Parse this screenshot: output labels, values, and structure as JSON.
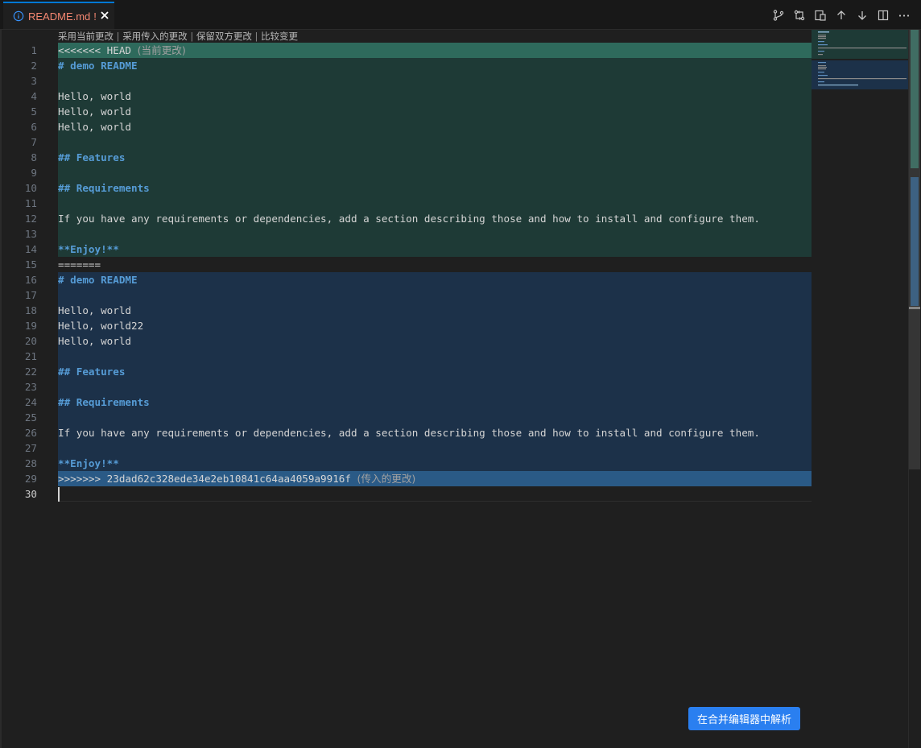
{
  "tab": {
    "file_name": "README.md",
    "modified_marker": "!",
    "icon": "info-icon",
    "close_icon": "close-icon"
  },
  "toolbar": {
    "icons": [
      "source-control-icon",
      "git-compare-icon",
      "open-changes-icon",
      "arrow-up-icon",
      "arrow-down-icon",
      "split-editor-icon",
      "more-actions-icon"
    ]
  },
  "codelens": {
    "accept_current": "采用当前更改",
    "accept_incoming": "采用传入的更改",
    "accept_both": "保留双方更改",
    "compare": "比较变更",
    "separator": " | "
  },
  "lines": [
    {
      "n": "1",
      "text": "<<<<<<< HEAD",
      "annotation": "(当前更改)",
      "kind": "marker"
    },
    {
      "n": "2",
      "text": "# demo README",
      "kind": "heading"
    },
    {
      "n": "3",
      "text": "",
      "kind": "text"
    },
    {
      "n": "4",
      "text": "Hello, world",
      "kind": "text"
    },
    {
      "n": "5",
      "text": "Hello, world",
      "kind": "text"
    },
    {
      "n": "6",
      "text": "Hello, world",
      "kind": "text"
    },
    {
      "n": "7",
      "text": "",
      "kind": "text"
    },
    {
      "n": "8",
      "text": "## Features",
      "kind": "heading"
    },
    {
      "n": "9",
      "text": "",
      "kind": "text"
    },
    {
      "n": "10",
      "text": "## Requirements",
      "kind": "heading"
    },
    {
      "n": "11",
      "text": "",
      "kind": "text"
    },
    {
      "n": "12",
      "text": "If you have any requirements or dependencies, add a section describing those and how to install and configure them.",
      "kind": "text"
    },
    {
      "n": "13",
      "text": "",
      "kind": "text"
    },
    {
      "n": "14",
      "text": "**Enjoy!**",
      "kind": "heading"
    },
    {
      "n": "15",
      "text": "=======",
      "kind": "separator"
    },
    {
      "n": "16",
      "text": "# demo README",
      "kind": "heading"
    },
    {
      "n": "17",
      "text": "",
      "kind": "text"
    },
    {
      "n": "18",
      "text": "Hello, world",
      "kind": "text"
    },
    {
      "n": "19",
      "text": "Hello, world22",
      "kind": "text"
    },
    {
      "n": "20",
      "text": "Hello, world",
      "kind": "text"
    },
    {
      "n": "21",
      "text": "",
      "kind": "text"
    },
    {
      "n": "22",
      "text": "## Features",
      "kind": "heading"
    },
    {
      "n": "23",
      "text": "",
      "kind": "text"
    },
    {
      "n": "24",
      "text": "## Requirements",
      "kind": "heading"
    },
    {
      "n": "25",
      "text": "",
      "kind": "text"
    },
    {
      "n": "26",
      "text": "If you have any requirements or dependencies, add a section describing those and how to install and configure them.",
      "kind": "text"
    },
    {
      "n": "27",
      "text": "",
      "kind": "text"
    },
    {
      "n": "28",
      "text": "**Enjoy!**",
      "kind": "heading"
    },
    {
      "n": "29",
      "text": ">>>>>>> 23dad62c328ede34e2eb10841c64aa4059a9916f",
      "annotation": "(传入的更改)",
      "kind": "marker"
    },
    {
      "n": "30",
      "text": "",
      "kind": "text",
      "active": true
    }
  ],
  "colors": {
    "current_header": "#2e6a5c",
    "current_body": "#1e3a36",
    "incoming_header": "#2a5a86",
    "incoming_body": "#1c3149",
    "heading_text": "#569cd6",
    "accent_button": "#2a7ff0"
  },
  "merge_button": {
    "label": "在合并编辑器中解析"
  }
}
